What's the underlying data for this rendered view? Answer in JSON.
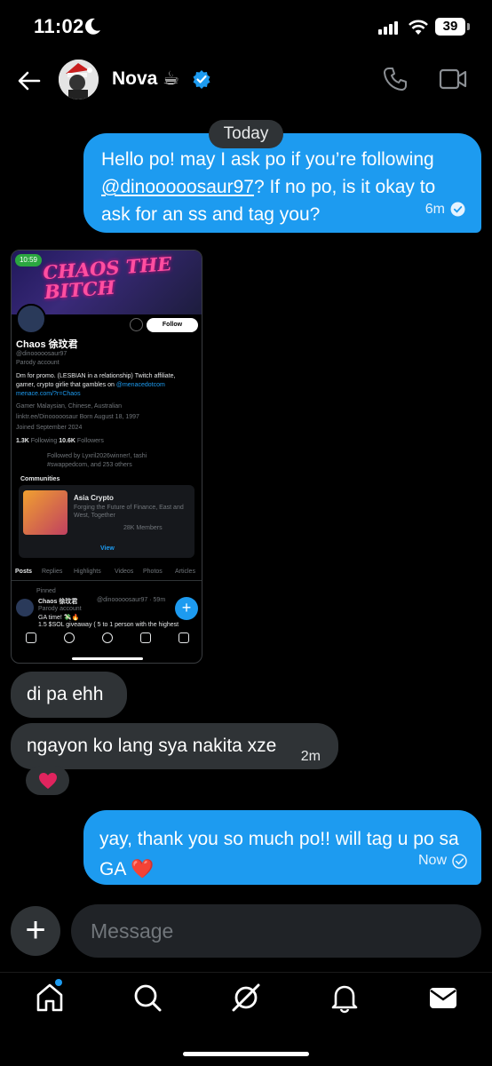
{
  "status_bar": {
    "time": "11:02",
    "battery": "39"
  },
  "header": {
    "contact_name": "Nova ☕"
  },
  "date_divider": "Today",
  "messages": [
    {
      "direction": "outgoing",
      "text_before": "Hello po! may I ask po if you’re following ",
      "mention": "@dinooooosaur97",
      "text_after": "? If no po, is it okay to ask for an ss and tag you?",
      "time": "6m"
    },
    {
      "direction": "incoming",
      "text": "di pa ehh"
    },
    {
      "direction": "incoming",
      "text": "ngayon ko lang sya nakita xze",
      "time": "2m",
      "reaction": "❤️"
    },
    {
      "direction": "outgoing",
      "text": "yay, thank you so much po!! will tag u po sa GA ❤️",
      "time": "Now"
    }
  ],
  "screenshot": {
    "clock": "10:59",
    "banner": "CHAOS THE BITCH",
    "follow": "Follow",
    "name": "Chaos 徐玟君",
    "handle": "@dinooooosaur97",
    "parody": "Parody account",
    "bio1": "Dm for promo. (LESBIAN in a relationship) Twitch affiliate,",
    "bio2": "gamer, crypto girlie that gambles on",
    "bio2_link": "@menacedotcom",
    "bio3": "menace.com/?r=Chaos",
    "meta1": "Gamer   Malaysian, Chinese, Australian",
    "meta2": "linktr.ee/Dinooooosaur   Born August 18, 1997",
    "meta3": "Joined September 2024",
    "following_count": "1.3K",
    "following_label": "Following",
    "followers_count": "10.6K",
    "followers_label": "Followers",
    "followed_by1": "Followed by Lyxril2026winner!, tashi",
    "followed_by2": "#swappedcom, and 253 others",
    "communities": "Communities",
    "community_name": "Asia Crypto",
    "community_desc1": "Forging the Future of Finance, East and",
    "community_desc2": "West, Together",
    "community_members": "28K Members",
    "view": "View",
    "tabs": [
      "Posts",
      "Replies",
      "Highlights",
      "Videos",
      "Photos",
      "Articles"
    ],
    "pinned": "Pinned",
    "post_author": "Chaos 徐玟君",
    "post_handle": "@dinooooosaur97 · 59m",
    "post_text": "GA time! 💸🔥",
    "post_text2": "1.5 $SOL giveaway ( 5 to 1 person with the highest"
  },
  "composer": {
    "placeholder": "Message"
  },
  "colors": {
    "accent": "#1d9bf0",
    "incoming": "#2f3336",
    "background": "#000000"
  }
}
